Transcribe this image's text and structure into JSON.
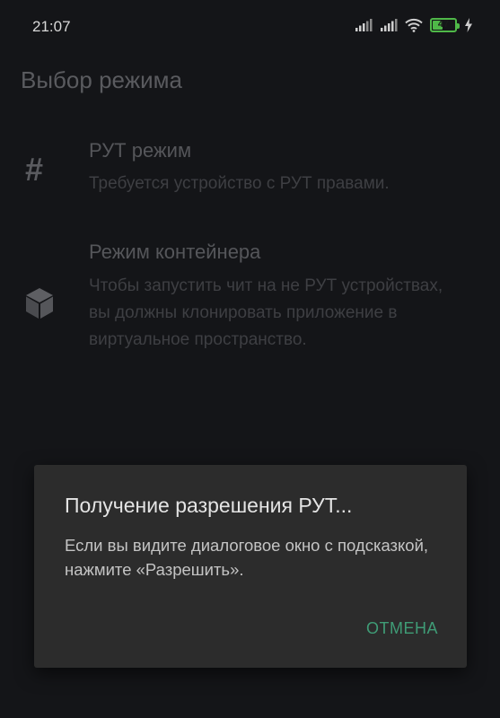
{
  "status_bar": {
    "time": "21:07",
    "battery_level": 47,
    "battery_label": "47",
    "icons": [
      "signal-icon",
      "signal-icon",
      "wifi-icon",
      "battery-icon",
      "charging-bolt-icon"
    ]
  },
  "app": {
    "title": "Выбор режима",
    "modes": [
      {
        "icon": "hash-icon",
        "title": "РУТ режим",
        "description": "Требуется устройство с РУТ правами."
      },
      {
        "icon": "cube-icon",
        "title": "Режим контейнера",
        "description": "Чтобы запустить чит на не РУТ устройствах, вы должны клонировать приложение в виртуальное пространство."
      }
    ]
  },
  "dialog": {
    "title": "Получение разрешения РУТ...",
    "message": "Если вы видите диалоговое окно с подсказкой, нажмите «Разрешить».",
    "cancel_label": "ОТМЕНА"
  },
  "colors": {
    "accent": "#3f9c76",
    "battery": "#4fb848",
    "dialog_bg": "#2c2c2c",
    "background": "#141518"
  }
}
